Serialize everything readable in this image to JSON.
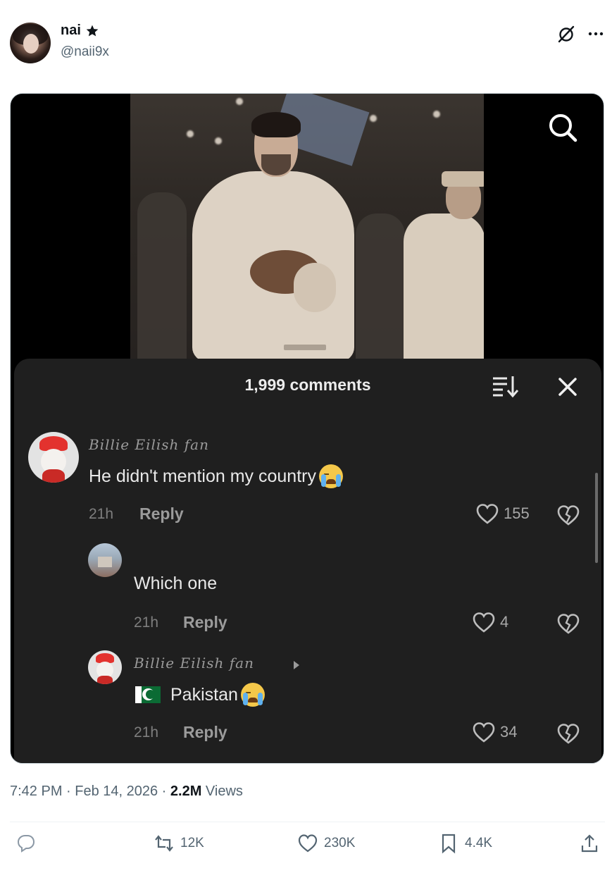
{
  "post": {
    "display_name": "nai",
    "handle": "@naii9x",
    "timestamp": "7:42 PM · Feb 14, 2026 · ",
    "views_count": "2.2M",
    "views_label": " Views"
  },
  "media": {
    "panel_title": "1,999 comments",
    "comments": [
      {
        "username": "Billie Eilish fan",
        "text": "He didn't mention my country",
        "time": "21h",
        "reply_label": "Reply",
        "likes": "155"
      },
      {
        "username": "",
        "text": "Which one",
        "time": "21h",
        "reply_label": "Reply",
        "likes": "4"
      },
      {
        "username": "Billie Eilish fan",
        "text": "Pakistan",
        "time": "21h",
        "reply_label": "Reply",
        "likes": "34"
      }
    ]
  },
  "actions": {
    "replies": "",
    "reposts": "12K",
    "likes": "230K",
    "bookmarks": "4.4K"
  },
  "icons": [
    "star-icon",
    "grok-icon",
    "more-icon",
    "search-icon",
    "sort-icon",
    "close-icon",
    "heart-icon",
    "broken-heart-icon",
    "reply-icon",
    "repost-icon",
    "like-icon",
    "bookmark-icon",
    "share-icon"
  ],
  "colors": {
    "text_primary": "#0f1419",
    "text_secondary": "#536471",
    "panel_bg": "#1f1f1f",
    "border": "#cfd9de"
  }
}
